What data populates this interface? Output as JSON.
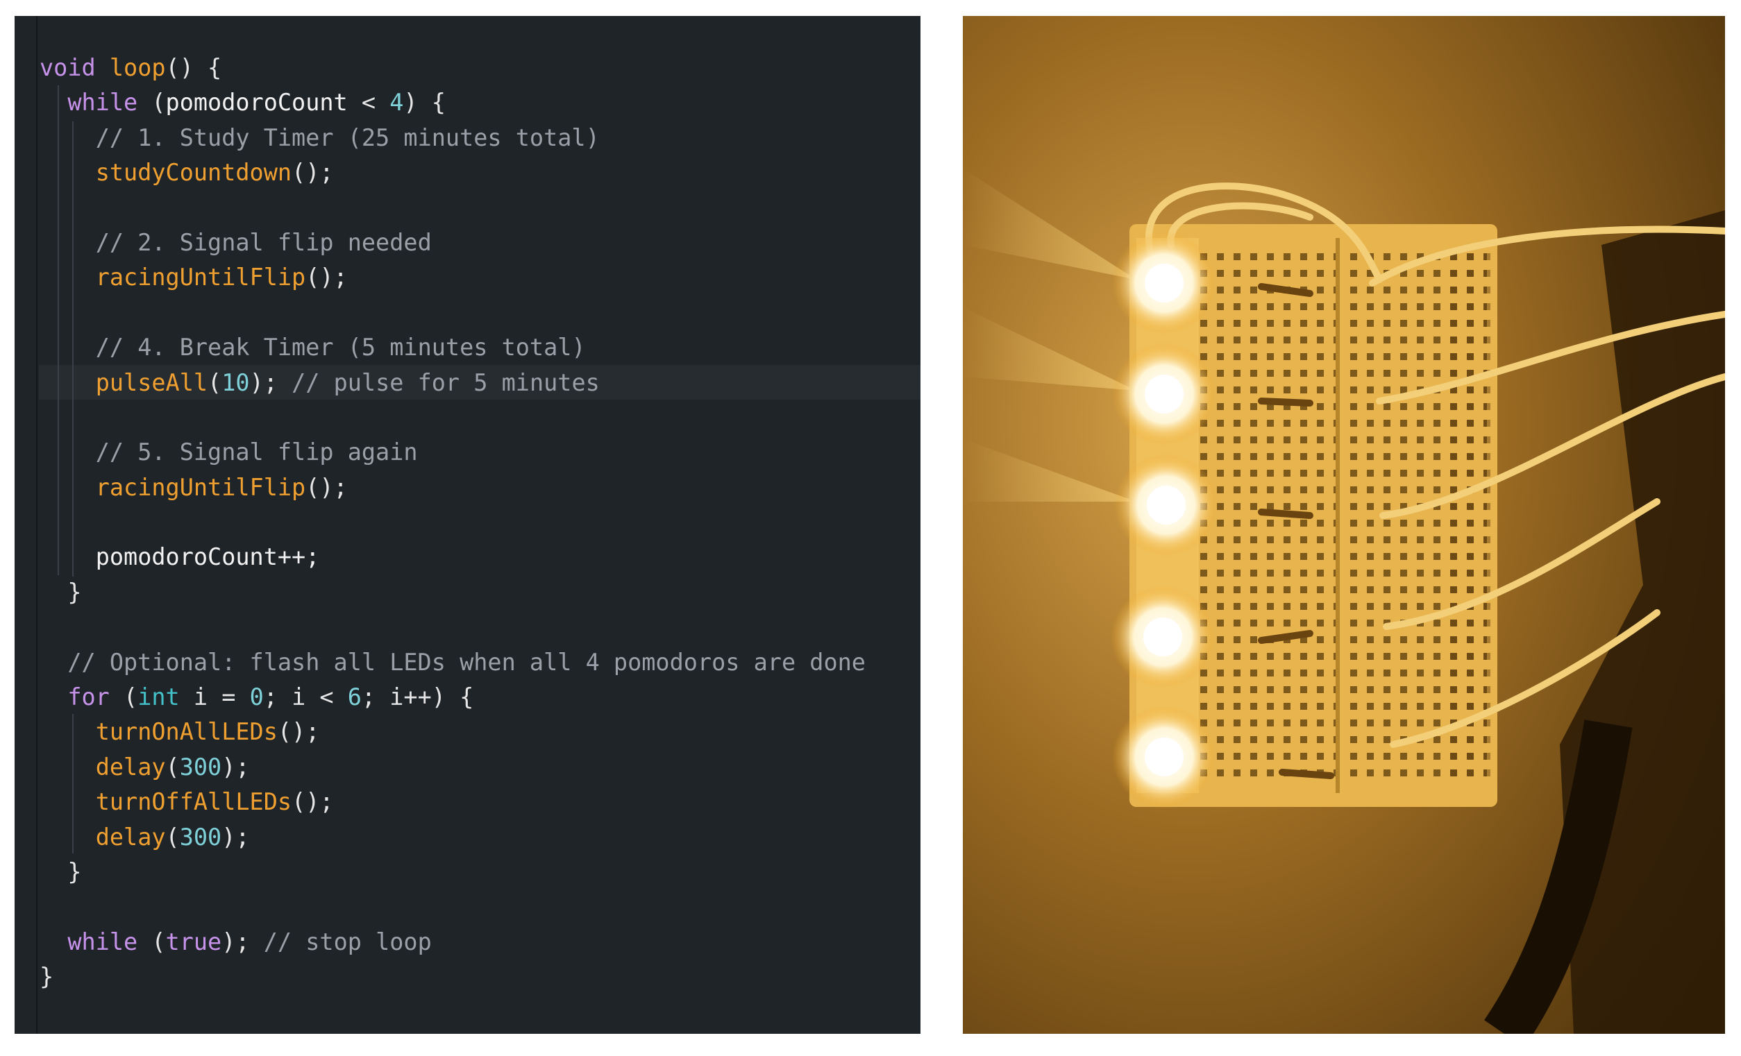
{
  "code_lines": [
    [
      [
        "kw",
        "void"
      ],
      [
        "punc",
        " "
      ],
      [
        "fn",
        "loop"
      ],
      [
        "punc",
        "() {"
      ]
    ],
    [
      [
        "punc",
        "  "
      ],
      [
        "kw",
        "while"
      ],
      [
        "punc",
        " ("
      ],
      [
        "id",
        "pomodoroCount"
      ],
      [
        "punc",
        " < "
      ],
      [
        "num",
        "4"
      ],
      [
        "punc",
        ") {"
      ]
    ],
    [
      [
        "punc",
        "    "
      ],
      [
        "cmt",
        "// 1. Study Timer (25 minutes total)"
      ]
    ],
    [
      [
        "punc",
        "    "
      ],
      [
        "fn",
        "studyCountdown"
      ],
      [
        "punc",
        "();"
      ]
    ],
    [
      [
        "punc",
        ""
      ]
    ],
    [
      [
        "punc",
        "    "
      ],
      [
        "cmt",
        "// 2. Signal flip needed"
      ]
    ],
    [
      [
        "punc",
        "    "
      ],
      [
        "fn",
        "racingUntilFlip"
      ],
      [
        "punc",
        "();"
      ]
    ],
    [
      [
        "punc",
        ""
      ]
    ],
    [
      [
        "punc",
        "    "
      ],
      [
        "cmt",
        "// 4. Break Timer (5 minutes total)"
      ]
    ],
    [
      [
        "punc",
        "    "
      ],
      [
        "fn",
        "pulseAll"
      ],
      [
        "punc",
        "("
      ],
      [
        "num",
        "10"
      ],
      [
        "punc",
        "); "
      ],
      [
        "cmt",
        "// pulse for 5 minutes"
      ]
    ],
    [
      [
        "punc",
        ""
      ]
    ],
    [
      [
        "punc",
        "    "
      ],
      [
        "cmt",
        "// 5. Signal flip again"
      ]
    ],
    [
      [
        "punc",
        "    "
      ],
      [
        "fn",
        "racingUntilFlip"
      ],
      [
        "punc",
        "();"
      ]
    ],
    [
      [
        "punc",
        ""
      ]
    ],
    [
      [
        "punc",
        "    "
      ],
      [
        "id",
        "pomodoroCount++;"
      ]
    ],
    [
      [
        "punc",
        "  }"
      ]
    ],
    [
      [
        "punc",
        ""
      ]
    ],
    [
      [
        "punc",
        "  "
      ],
      [
        "cmt",
        "// Optional: flash all LEDs when all 4 pomodoros are done"
      ]
    ],
    [
      [
        "punc",
        "  "
      ],
      [
        "kw",
        "for"
      ],
      [
        "punc",
        " ("
      ],
      [
        "typ",
        "int"
      ],
      [
        "punc",
        " i = "
      ],
      [
        "num",
        "0"
      ],
      [
        "punc",
        "; i < "
      ],
      [
        "num",
        "6"
      ],
      [
        "punc",
        "; i++) {"
      ]
    ],
    [
      [
        "punc",
        "    "
      ],
      [
        "fn",
        "turnOnAllLEDs"
      ],
      [
        "punc",
        "();"
      ]
    ],
    [
      [
        "punc",
        "    "
      ],
      [
        "fn",
        "delay"
      ],
      [
        "punc",
        "("
      ],
      [
        "num",
        "300"
      ],
      [
        "punc",
        ");"
      ]
    ],
    [
      [
        "punc",
        "    "
      ],
      [
        "fn",
        "turnOffAllLEDs"
      ],
      [
        "punc",
        "();"
      ]
    ],
    [
      [
        "punc",
        "    "
      ],
      [
        "fn",
        "delay"
      ],
      [
        "punc",
        "("
      ],
      [
        "num",
        "300"
      ],
      [
        "punc",
        ");"
      ]
    ],
    [
      [
        "punc",
        "  }"
      ]
    ],
    [
      [
        "punc",
        ""
      ]
    ],
    [
      [
        "punc",
        "  "
      ],
      [
        "kw",
        "while"
      ],
      [
        "punc",
        " ("
      ],
      [
        "kw",
        "true"
      ],
      [
        "punc",
        "); "
      ],
      [
        "cmt",
        "// stop loop"
      ]
    ],
    [
      [
        "punc",
        "}"
      ]
    ]
  ],
  "photo": {
    "description_icon": "breadboard-photo",
    "led_color": "#fff6d8",
    "glow_color": "#f2a91c"
  },
  "colors": {
    "editor_bg": "#1f2428",
    "keyword": "#c792ea",
    "function": "#f0a030",
    "number": "#7fd1d9",
    "comment": "#9aa0a8"
  }
}
